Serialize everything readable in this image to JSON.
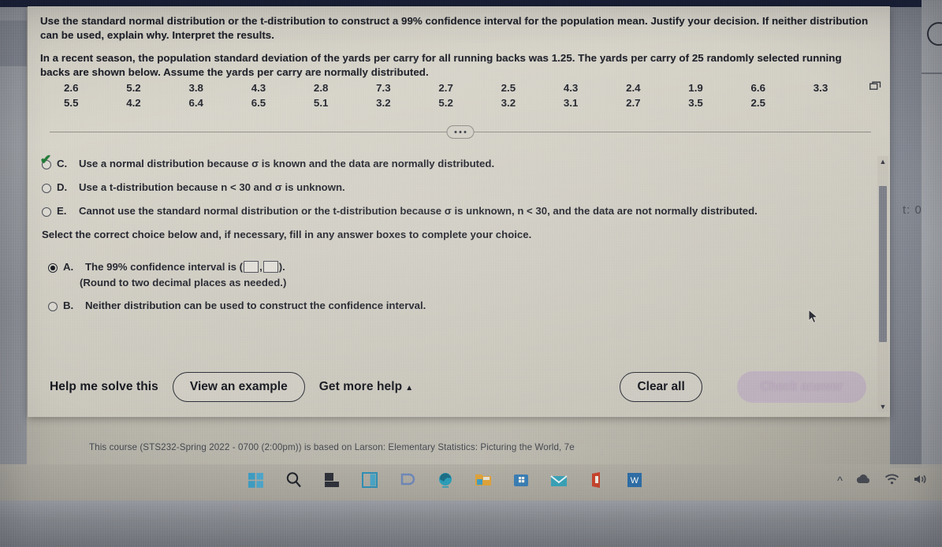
{
  "question": {
    "prompt_line1": "Use the standard normal distribution or the t-distribution to construct a 99% confidence interval for the population mean. Justify your decision. If neither distribution",
    "prompt_line2": "can be used, explain why. Interpret the results.",
    "context_line1": "In a recent season, the population standard deviation of the yards per carry for all running backs was 1.25. The yards per carry of 25 randomly selected running",
    "context_line2": "backs are shown below. Assume the yards per carry are normally distributed."
  },
  "data_table": {
    "row1": [
      "2.6",
      "5.2",
      "3.8",
      "4.3",
      "2.8",
      "7.3",
      "2.7",
      "2.5",
      "4.3",
      "2.4",
      "1.9",
      "6.6",
      "3.3"
    ],
    "row2": [
      "5.5",
      "4.2",
      "6.4",
      "6.5",
      "5.1",
      "3.2",
      "5.2",
      "3.2",
      "3.1",
      "2.7",
      "3.5",
      "2.5",
      ""
    ]
  },
  "copy_icon": "copy-to-clipboard-icon",
  "divider": {
    "ellipsis": "..."
  },
  "distribution_choices": [
    {
      "letter": "C.",
      "text": "Use a normal distribution because σ is known and the data are normally distributed.",
      "selected": false,
      "marked_correct": true
    },
    {
      "letter": "D.",
      "text": "Use a t-distribution because n < 30 and σ is unknown.",
      "selected": false,
      "marked_correct": false
    },
    {
      "letter": "E.",
      "text": "Cannot use the standard normal distribution or the t-distribution because σ is unknown, n < 30, and the data are not normally distributed.",
      "selected": false,
      "marked_correct": false
    }
  ],
  "select_prompt": "Select the correct choice below and, if necessary, fill in any answer boxes to complete your choice.",
  "interval_choices": [
    {
      "letter": "A.",
      "text_before_boxes": "The 99% confidence interval is (",
      "box1_value": "",
      "box2_value": "",
      "separator": ",",
      "text_after_boxes": ").",
      "subnote": "(Round to two decimal places as needed.)",
      "selected": true
    },
    {
      "letter": "B.",
      "text": "Neither distribution can be used to construct the confidence interval.",
      "selected": false
    }
  ],
  "actions": {
    "help_me_solve": "Help me solve this",
    "view_example": "View an example",
    "get_more_help": "Get more help",
    "get_more_help_caret": "▲",
    "clear_all": "Clear all",
    "check_answer": "Check answer"
  },
  "footer": {
    "note": "This course (STS232-Spring 2022 - 0700 (2:00pm)) is based on Larson: Elementary Statistics: Picturing the World, 7e"
  },
  "scrollbar": {
    "up_arrow": "▲",
    "down_arrow": "▼"
  },
  "desktop": {
    "ghost_text": "t: 0",
    "taskbar_icons": [
      "windows-start-icon",
      "search-icon",
      "task-view-icon",
      "widgets-icon",
      "chat-teams-icon",
      "edge-browser-icon",
      "file-explorer-icon",
      "microsoft-store-icon",
      "mail-icon",
      "office-icon",
      "word-icon"
    ],
    "tray_icons": [
      "show-hidden-icons-chevron",
      "onedrive-cloud-icon",
      "wifi-icon",
      "volume-icon"
    ]
  },
  "colors": {
    "accent_checkmark": "#1f7a35",
    "check_answer_bg": "#b9a6c1",
    "text": "#20222b",
    "window_bg": "#d0cdc3",
    "top_bar": "#161d36"
  }
}
